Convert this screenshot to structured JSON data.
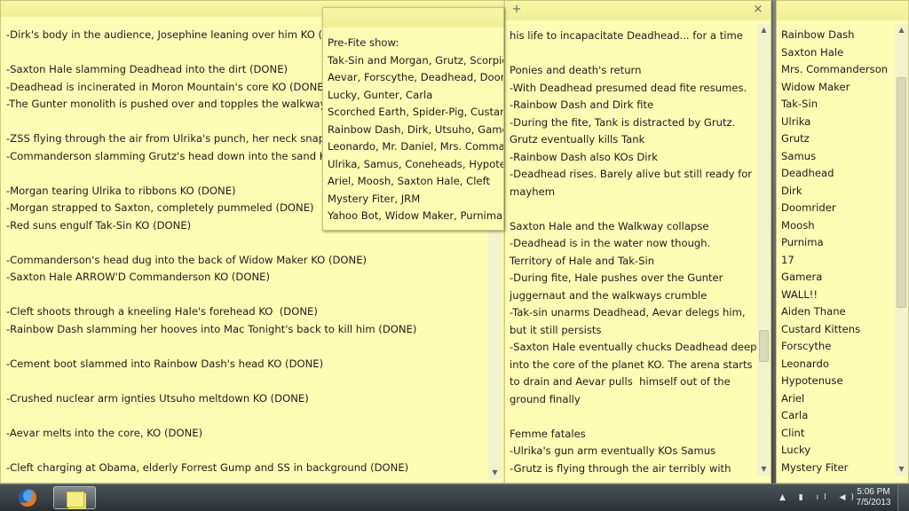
{
  "note_left": {
    "text": "-Dirk's body in the audience, Josephine leaning over him KO (DONE)\n\n-Saxton Hale slamming Deadhead into the dirt (DONE)\n-Deadhead is incinerated in Moron Mountain's core KO (DONE)\n-The Gunter monolith is pushed over and topples the walkways\n\n-ZSS flying through the air from Ulrika's punch, her neck snapped\n-Commanderson slamming Grutz's head down into the sand KO\n\n-Morgan tearing Ulrika to ribbons KO (DONE)\n-Morgan strapped to Saxton, completely pummeled (DONE)\n-Red suns engulf Tak-Sin KO (DONE)\n\n-Commanderson's head dug into the back of Widow Maker KO (DONE)\n-Saxton Hale ARROW'D Commanderson KO (DONE)\n\n-Cleft shoots through a kneeling Hale's forehead KO  (DONE)\n-Rainbow Dash slamming her hooves into Mac Tonight's back to kill him (DONE)\n\n-Cement boot slammed into Rainbow Dash's head KO (DONE)\n\n-Crushed nuclear arm ignties Utsuho meltdown KO (DONE)\n\n-Aevar melts into the core, KO (DONE)\n\n-Cleft charging at Obama, elderly Forrest Gump and SS in background (DONE)"
  },
  "note_prefite": {
    "text": "Pre-Fite show:\nTak-Sin and Morgan, Grutz, Scorpion\nAevar, Forscythe, Deadhead, Doomrider\nLucky, Gunter, Carla\nScorched Earth, Spider-Pig, Custard\nRainbow Dash, Dirk, Utsuho, Gamera\nLeonardo, Mr. Daniel, Mrs. Commanderson\nUlrika, Samus, Coneheads, Hypotenuse\nAriel, Moosh, Saxton Hale, Cleft\nMystery Fiter, JRM\nYahoo Bot, Widow Maker, Purnima"
  },
  "note_middle": {
    "add_glyph": "+",
    "close_glyph": "×",
    "text": "his life to incapacitate Deadhead... for a time\n\nPonies and death's return\n-With Deadhead presumed dead fite resumes.\n-Rainbow Dash and Dirk fite\n-During the fite, Tank is distracted by Grutz.\nGrutz eventually kills Tank\n-Rainbow Dash also KOs Dirk\n-Deadhead rises. Barely alive but still ready for\nmayhem\n\nSaxton Hale and the Walkway collapse\n-Deadhead is in the water now though.\nTerritory of Hale and Tak-Sin\n-During fite, Hale pushes over the Gunter\njuggernaut and the walkways crumble\n-Tak-sin unarms Deadhead, Aevar delegs him,\nbut it still persists\n-Saxton Hale eventually chucks Deadhead deep\ninto the core of the planet KO. The arena starts\nto drain and Aevar pulls  himself out of the\nground finally\n\nFemme fatales\n-Ulrika's gun arm eventually KOs Samus\n-Grutz is flying through the air terribly with"
  },
  "note_right": {
    "text": "Rainbow Dash\nSaxton Hale\nMrs. Commanderson\nWidow Maker\nTak-Sin\nUlrika\nGrutz\nSamus\nDeadhead\nDirk\nDoomrider\nMoosh\nPurnima\n17\nGamera\nWALL!!\nAiden Thane\nCustard Kittens\nForscythe\nLeonardo\nHypotenuse\nAriel\nCarla\nClint\nLucky\nMystery Fiter"
  },
  "taskbar": {
    "apps": [
      "firefox-icon",
      "sticky-notes-icon"
    ],
    "time": "5:06 PM",
    "date": "7/5/2013"
  }
}
